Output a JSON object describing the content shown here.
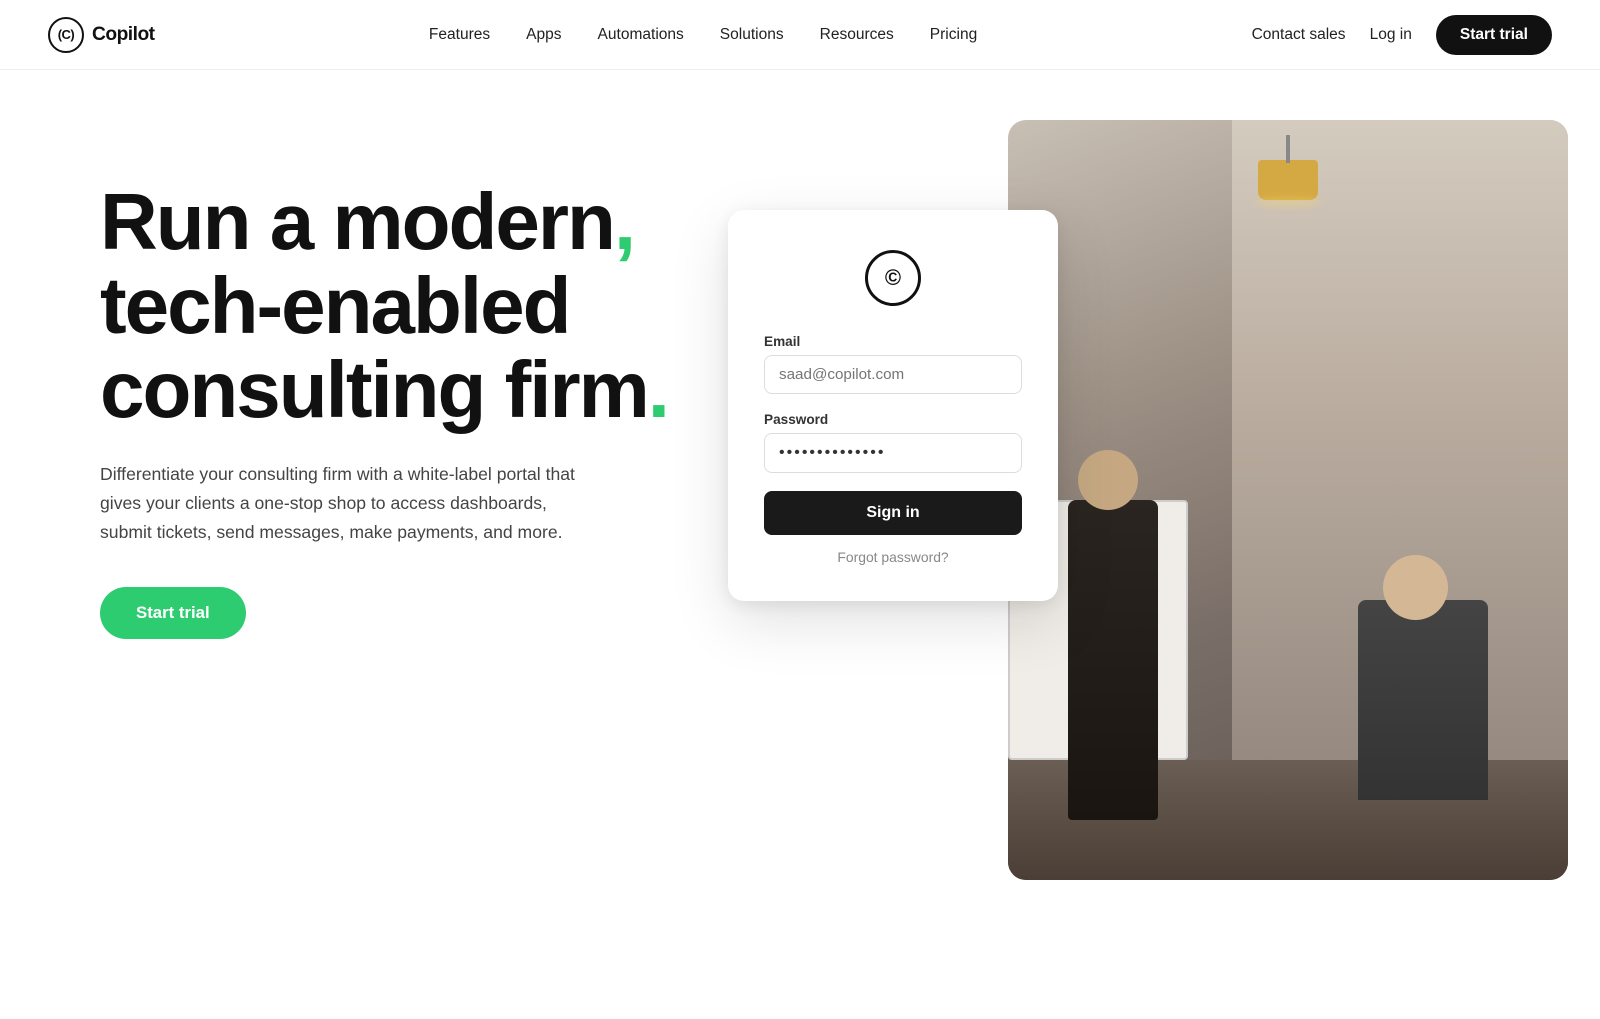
{
  "nav": {
    "logo_icon": "(C)",
    "logo_text": "Copilot",
    "links": [
      {
        "label": "Features",
        "id": "features"
      },
      {
        "label": "Apps",
        "id": "apps"
      },
      {
        "label": "Automations",
        "id": "automations"
      },
      {
        "label": "Solutions",
        "id": "solutions"
      },
      {
        "label": "Resources",
        "id": "resources"
      },
      {
        "label": "Pricing",
        "id": "pricing"
      }
    ],
    "contact_sales": "Contact sales",
    "login": "Log in",
    "start_trial": "Start trial"
  },
  "hero": {
    "headline_line1": "Run a modern,",
    "headline_line2": "tech-enabled",
    "headline_line3": "consulting firm.",
    "description": "Differentiate your consulting firm with a white-label portal that gives your clients a one-stop shop to access dashboards, submit tickets, send messages, make payments, and more.",
    "cta_label": "Start trial"
  },
  "login_card": {
    "logo_icon": "©",
    "email_label": "Email",
    "email_placeholder": "saad@copilot.com",
    "password_label": "Password",
    "password_value": "••••••••••••••",
    "signin_label": "Sign in",
    "forgot_label": "Forgot password?"
  },
  "colors": {
    "accent_green": "#2ecc71",
    "dark": "#111111",
    "nav_bg": "#ffffff"
  }
}
